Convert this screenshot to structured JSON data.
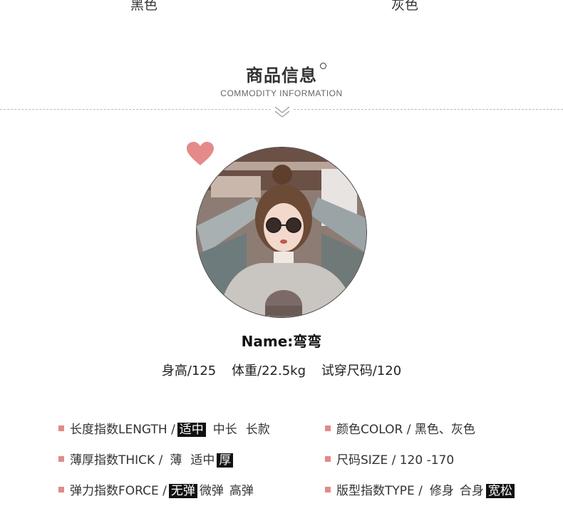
{
  "colors_top": {
    "left": "黑色",
    "right": "灰色"
  },
  "section": {
    "title": "商品信息",
    "subtitle": "COMMODITY INFORMATION"
  },
  "model": {
    "name": "Name:弯弯",
    "stats": [
      "身高/125",
      "体重/22.5kg",
      "试穿尺码/120"
    ]
  },
  "specs_left": [
    {
      "label": "长度指数LENGTH /",
      "options": [
        "适中",
        "中长",
        "长款"
      ],
      "selected": 0
    },
    {
      "label": "薄厚指数THICK /",
      "options": [
        "薄",
        "适中",
        "厚"
      ],
      "selected": 2
    },
    {
      "label": "弹力指数FORCE /",
      "options": [
        "无弹",
        "微弹",
        "高弹"
      ],
      "selected": 0
    }
  ],
  "specs_right": [
    {
      "text": "颜色COLOR / 黑色、灰色"
    },
    {
      "text": "尺码SIZE / 120 -170"
    },
    {
      "label": "版型指数TYPE /",
      "options": [
        "修身",
        "合身",
        "宽松"
      ],
      "selected": 2
    }
  ],
  "palette": {
    "bullet": "#e08b8b",
    "heart": "#e58a8a",
    "highlight_bg": "#111111"
  }
}
